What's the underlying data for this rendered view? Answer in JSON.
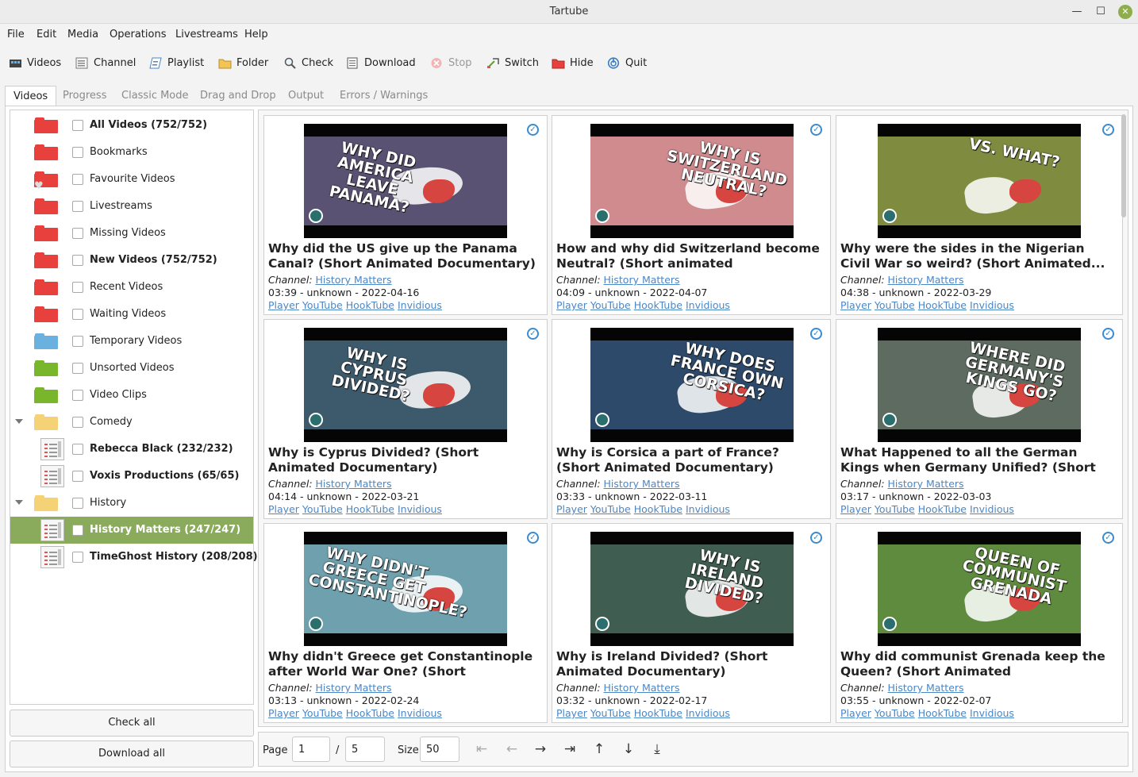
{
  "window": {
    "title": "Tartube"
  },
  "menu": [
    "File",
    "Edit",
    "Media",
    "Operations",
    "Livestreams",
    "Help"
  ],
  "toolbar": {
    "videos": "Videos",
    "channel": "Channel",
    "playlist": "Playlist",
    "folder": "Folder",
    "check": "Check",
    "download": "Download",
    "stop": "Stop",
    "switch": "Switch",
    "hide": "Hide",
    "quit": "Quit"
  },
  "tabs": [
    "Videos",
    "Progress",
    "Classic Mode",
    "Drag and Drop",
    "Output",
    "Errors / Warnings"
  ],
  "tree": [
    {
      "label": "All Videos (752/752)",
      "bold": true,
      "icon": "folder-red-icon"
    },
    {
      "label": "Bookmarks",
      "bold": false,
      "icon": "folder-red-icon"
    },
    {
      "label": "Favourite Videos",
      "bold": false,
      "icon": "folder-red-heart-icon"
    },
    {
      "label": "Livestreams",
      "bold": false,
      "icon": "folder-red-icon"
    },
    {
      "label": "Missing Videos",
      "bold": false,
      "icon": "folder-red-icon"
    },
    {
      "label": "New Videos (752/752)",
      "bold": true,
      "icon": "folder-red-icon"
    },
    {
      "label": "Recent Videos",
      "bold": false,
      "icon": "folder-red-icon"
    },
    {
      "label": "Waiting Videos",
      "bold": false,
      "icon": "folder-red-icon"
    },
    {
      "label": "Temporary Videos",
      "bold": false,
      "icon": "folder-blue-icon"
    },
    {
      "label": "Unsorted Videos",
      "bold": false,
      "icon": "folder-green-icon"
    },
    {
      "label": "Video Clips",
      "bold": false,
      "icon": "folder-green-icon"
    },
    {
      "label": "Comedy",
      "bold": false,
      "icon": "folder-yellow-icon"
    },
    {
      "label": "Rebecca Black (232/232)",
      "bold": true,
      "icon": "channel-icon"
    },
    {
      "label": "Voxis Productions (65/65)",
      "bold": true,
      "icon": "channel-icon"
    },
    {
      "label": "History",
      "bold": false,
      "icon": "folder-yellow-icon"
    },
    {
      "label": "History Matters (247/247)",
      "bold": true,
      "icon": "channel-icon"
    },
    {
      "label": "TimeGhost History (208/208)",
      "bold": true,
      "icon": "channel-icon"
    }
  ],
  "sidebar_buttons": {
    "check_all": "Check all",
    "download_all": "Download all"
  },
  "card_labels": {
    "channel_label": "Channel:",
    "links": [
      "Player",
      "YouTube",
      "HookTube",
      "Invidious"
    ]
  },
  "videos": [
    {
      "title": "Why did the US give up the Panama Canal? (Short Animated Documentary)",
      "channel": "History Matters",
      "meta": "03:39 - unknown - 2022-04-16",
      "thumb_text": "Why did America leave Panama?",
      "bg": "#5a5272"
    },
    {
      "title": "How and why did Switzerland become Neutral? (Short animated documentary)",
      "channel": "History Matters",
      "meta": "04:09 - unknown - 2022-04-07",
      "thumb_text": "Why is Switzerland Neutral?",
      "bg": "#cf8b8e"
    },
    {
      "title": "Why were the sides in the Nigerian Civil War so weird? (Short Animated...",
      "channel": "History Matters",
      "meta": "04:38 - unknown - 2022-03-29",
      "thumb_text": "Vs. What?",
      "bg": "#7f8c40"
    },
    {
      "title": "Why is Cyprus Divided? (Short Animated Documentary)",
      "channel": "History Matters",
      "meta": "04:14 - unknown - 2022-03-21",
      "thumb_text": "Why is Cyprus Divided?",
      "bg": "#3d5a6c"
    },
    {
      "title": "Why is Corsica a part of France? (Short Animated Documentary)",
      "channel": "History Matters",
      "meta": "03:33 - unknown - 2022-03-11",
      "thumb_text": "Why does France own Corsica?",
      "bg": "#2d4a6b"
    },
    {
      "title": "What Happened to all the German Kings when Germany Unified? (Short Animated...",
      "channel": "History Matters",
      "meta": "03:17 - unknown - 2022-03-03",
      "thumb_text": "Where did Germany's Kings go?",
      "bg": "#5d6b60"
    },
    {
      "title": "Why didn't Greece get Constantinople after World War One? (Short Animated...",
      "channel": "History Matters",
      "meta": "03:13 - unknown - 2022-02-24",
      "thumb_text": "Why didn't Greece get Constantinople?",
      "bg": "#6fa0ad"
    },
    {
      "title": "Why is Ireland Divided? (Short Animated Documentary)",
      "channel": "History Matters",
      "meta": "03:32 - unknown - 2022-02-17",
      "thumb_text": "Why is Ireland Divided?",
      "bg": "#3f5d50"
    },
    {
      "title": "Why did communist Grenada keep the Queen? (Short Animated Documentary)",
      "channel": "History Matters",
      "meta": "03:55 - unknown - 2022-02-07",
      "thumb_text": "Queen of Communist Grenada",
      "bg": "#5f8b3e"
    }
  ],
  "pager": {
    "page_label": "Page",
    "page": "1",
    "slash": "/",
    "pages": "5",
    "size_label": "Size",
    "size": "50"
  }
}
